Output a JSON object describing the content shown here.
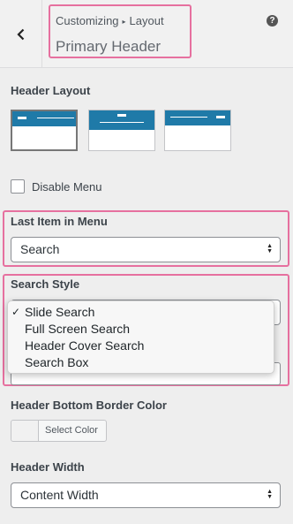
{
  "header": {
    "breadcrumb_root": "Customizing",
    "breadcrumb_sep": "▸",
    "breadcrumb_current": "Layout",
    "panel_title": "Primary Header",
    "help": "?"
  },
  "header_layout": {
    "label": "Header Layout",
    "options": [
      "layout-left",
      "layout-center",
      "layout-right"
    ],
    "selected": 0
  },
  "disable_menu": {
    "label": "Disable Menu",
    "checked": false
  },
  "last_item": {
    "label": "Last Item in Menu",
    "value": "Search"
  },
  "search_style": {
    "label": "Search Style",
    "options": [
      "Slide Search",
      "Full Screen Search",
      "Header Cover Search",
      "Search Box"
    ],
    "checkmark": "✓"
  },
  "bottom_border": {
    "label": "Header Bottom Border Color",
    "button": "Select Color"
  },
  "header_width": {
    "label": "Header Width",
    "value": "Content Width"
  },
  "colors": {
    "accent_highlight": "#e6709f",
    "header_blue": "#1f7aa8"
  }
}
